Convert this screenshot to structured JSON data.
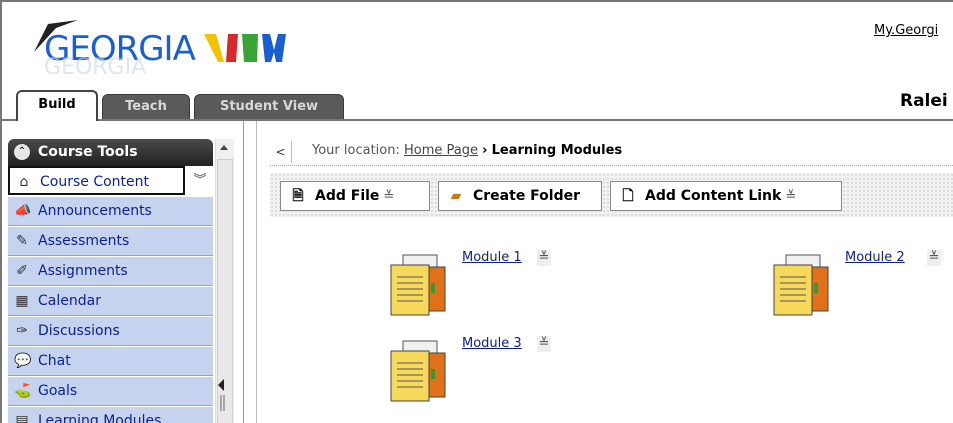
{
  "header": {
    "logo_text": "GEORGIAVIEW",
    "logo_part1": "GEORGIA",
    "logo_part2": "VIEW",
    "top_link": "My.Georgi",
    "course_name": "Ralei"
  },
  "tabs": [
    {
      "label": "Build",
      "active": true
    },
    {
      "label": "Teach",
      "active": false
    },
    {
      "label": "Student View",
      "active": false
    }
  ],
  "sidebar": {
    "section_title": "Course Tools",
    "items": [
      {
        "label": "Course Content",
        "icon": "home-icon",
        "selected": true
      },
      {
        "label": "Announcements",
        "icon": "megaphone-icon"
      },
      {
        "label": "Assessments",
        "icon": "assessment-icon"
      },
      {
        "label": "Assignments",
        "icon": "assignment-icon"
      },
      {
        "label": "Calendar",
        "icon": "calendar-icon"
      },
      {
        "label": "Discussions",
        "icon": "pushpin-icon"
      },
      {
        "label": "Chat",
        "icon": "chat-bubble-icon"
      },
      {
        "label": "Goals",
        "icon": "goals-icon"
      },
      {
        "label": "Learning Modules",
        "icon": "learning-modules-icon"
      }
    ]
  },
  "breadcrumb": {
    "prefix": "Your location:",
    "home": "Home Page",
    "separator": "›",
    "current": "Learning Modules"
  },
  "toolbar": {
    "add_file": "Add File",
    "create_folder": "Create Folder",
    "add_content_link": "Add Content Link"
  },
  "modules": [
    {
      "label": "Module 1"
    },
    {
      "label": "Module 2"
    },
    {
      "label": "Module 3"
    }
  ],
  "colors": {
    "sidebar_item_bg": "#c5d3ef",
    "link_blue": "#0b1f93",
    "logo_blue": "#1a5fd1",
    "logo_yellow": "#f2c200",
    "logo_green": "#3aa335",
    "logo_red": "#d42a2a"
  }
}
